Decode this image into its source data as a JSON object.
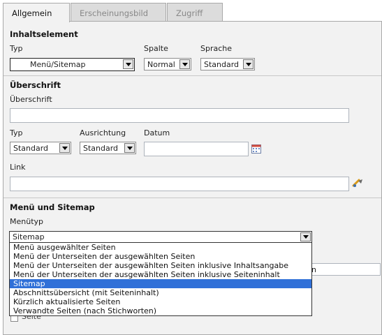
{
  "tabs": [
    {
      "label": "Allgemein",
      "active": true
    },
    {
      "label": "Erscheinungsbild",
      "active": false
    },
    {
      "label": "Zugriff",
      "active": false
    }
  ],
  "content_element": {
    "header": "Inhaltselement",
    "typ_label": "Typ",
    "typ_value": "Menü/Sitemap",
    "spalte_label": "Spalte",
    "spalte_value": "Normal",
    "sprache_label": "Sprache",
    "sprache_value": "Standard"
  },
  "heading_section": {
    "header": "Überschrift",
    "ueberschrift_label": "Überschrift",
    "ueberschrift_value": "",
    "typ_label": "Typ",
    "typ_value": "Standard",
    "ausrichtung_label": "Ausrichtung",
    "ausrichtung_value": "Standard",
    "datum_label": "Datum",
    "datum_value": "",
    "link_label": "Link",
    "link_value": ""
  },
  "menu_section": {
    "header": "Menü und Sitemap",
    "menutyp_label": "Menütyp",
    "menutyp_value": "Sitemap",
    "options": [
      "Menü ausgewählter Seiten",
      "Menü der Unterseiten der ausgewählten Seiten",
      "Menü der Unterseiten der ausgewählten Seiten inklusive Inhaltsangabe",
      "Menü der Unterseiten der ausgewählten Seiten inklusive Seiteninhalt",
      "Sitemap",
      "Abschnittsübersicht (mit Seiteninhalt)",
      "Kürzlich aktualisierte Seiten",
      "Verwandte Seiten (nach Stichworten)"
    ],
    "selected_index": 4,
    "hidden_field_fragment": "n",
    "checkbox_label_fragment": "Seite"
  },
  "colors": {
    "selection": "#3070d8",
    "panel": "#f2f2f2",
    "tab_inactive": "#dcdcdc"
  },
  "icons": {
    "select_arrow": "chevron-down-icon",
    "calendar": "calendar-icon",
    "link_wizard": "link-wizard-icon"
  }
}
